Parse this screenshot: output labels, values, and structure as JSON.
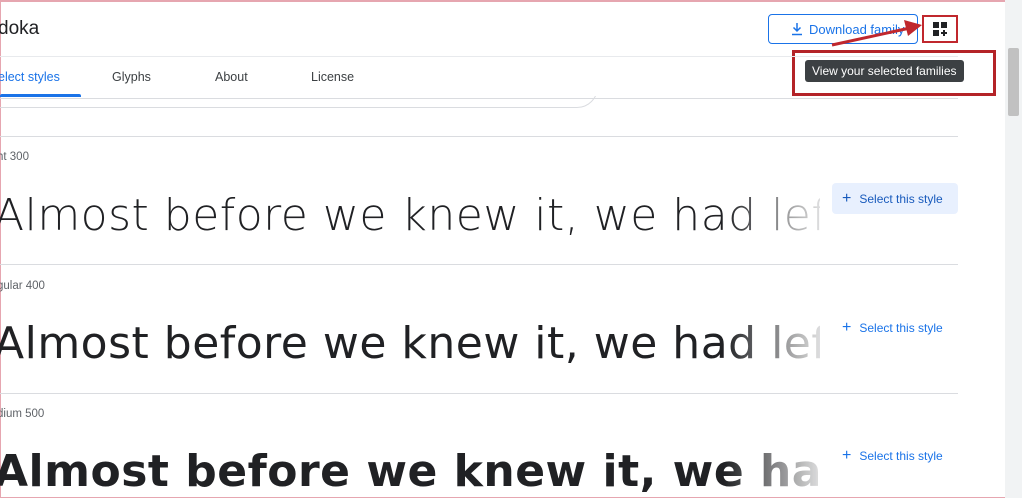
{
  "header": {
    "title": "doka",
    "download_label": "Download family",
    "grid_icon": "selected-families-icon",
    "tooltip": "View your selected families"
  },
  "tabs": [
    {
      "label": "elect styles",
      "active": true
    },
    {
      "label": "Glyphs",
      "active": false
    },
    {
      "label": "About",
      "active": false
    },
    {
      "label": "License",
      "active": false
    }
  ],
  "styles": [
    {
      "name": "ht 300",
      "sample": "Almost before we knew it, we had left",
      "select_label": "Select this style"
    },
    {
      "name": "gular 400",
      "sample": "Almost before we knew it, we had left",
      "select_label": "Select this style"
    },
    {
      "name": "dium 500",
      "sample": "Almost before we knew it, we had left",
      "select_label": "Select this style"
    }
  ],
  "colors": {
    "accent": "#1a73e8",
    "annotation": "#c0272d",
    "tooltip_bg": "#3c4043"
  }
}
